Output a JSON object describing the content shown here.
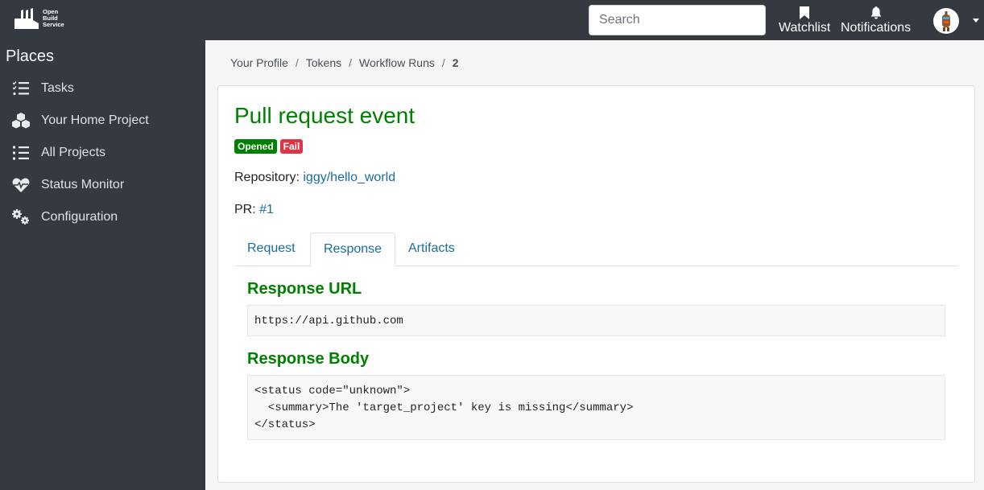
{
  "header": {
    "logo_lines": [
      "Open",
      "Build",
      "Service"
    ],
    "search": {
      "placeholder": "Search",
      "value": ""
    },
    "watchlist_label": "Watchlist",
    "notifications_label": "Notifications"
  },
  "sidebar": {
    "heading": "Places",
    "items": [
      {
        "label": "Tasks",
        "icon": "tasks-icon"
      },
      {
        "label": "Your Home Project",
        "icon": "cubes-icon"
      },
      {
        "label": "All Projects",
        "icon": "list-icon"
      },
      {
        "label": "Status Monitor",
        "icon": "heartbeat-icon"
      },
      {
        "label": "Configuration",
        "icon": "cogs-icon"
      }
    ]
  },
  "breadcrumb": {
    "items": [
      "Your Profile",
      "Tokens",
      "Workflow Runs"
    ],
    "separator": "/",
    "current": "2"
  },
  "run": {
    "title": "Pull request event",
    "badges": [
      {
        "label": "Opened",
        "color": "#008000"
      },
      {
        "label": "Fail",
        "color": "#dc3545"
      }
    ],
    "repository_label": "Repository:",
    "repository_value": "iggy/hello_world",
    "pr_label": "PR:",
    "pr_value": "#1"
  },
  "tabs": [
    {
      "label": "Request",
      "active": false
    },
    {
      "label": "Response",
      "active": true
    },
    {
      "label": "Artifacts",
      "active": false
    }
  ],
  "response": {
    "url_heading": "Response URL",
    "url_value": "https://api.github.com",
    "body_heading": "Response Body",
    "body_value": "<status code=\"unknown\">\n  <summary>The 'target_project' key is missing</summary>\n</status>"
  },
  "colors": {
    "topbar": "#343a40",
    "accent_green": "#008000",
    "link_blue": "#1a6c9c",
    "danger": "#dc3545"
  }
}
